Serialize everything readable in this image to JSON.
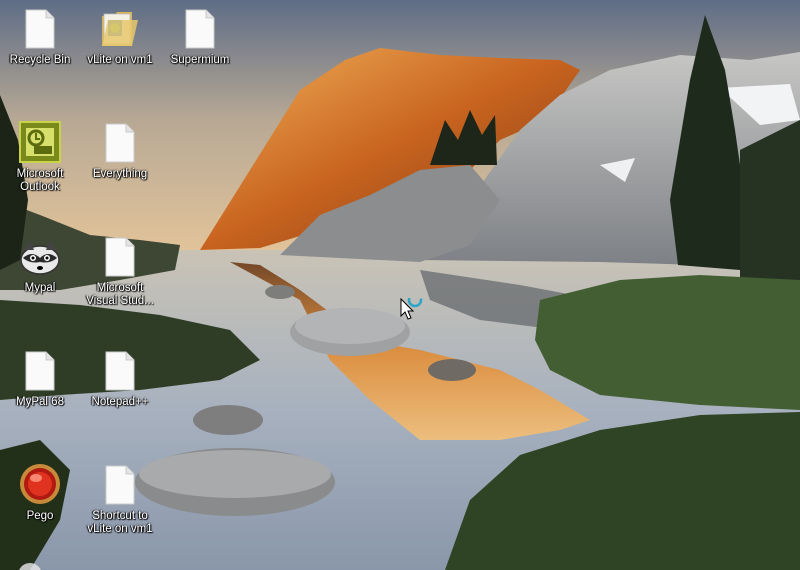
{
  "desktop": {
    "icons": [
      {
        "label": "Recycle Bin",
        "icon": "blank-file-icon"
      },
      {
        "label": "vLite on vm1",
        "icon": "folder-icon"
      },
      {
        "label": "Supermium",
        "icon": "blank-file-icon"
      },
      {
        "label": "Microsoft Outlook",
        "icon": "outlook-icon"
      },
      {
        "label": "Everything",
        "icon": "blank-file-icon"
      },
      {
        "label": "Mypal",
        "icon": "raccoon-icon"
      },
      {
        "label": "Microsoft Visual Stud...",
        "icon": "blank-file-icon"
      },
      {
        "label": "MyPal 68",
        "icon": "blank-file-icon"
      },
      {
        "label": "Notepad++",
        "icon": "blank-file-icon"
      },
      {
        "label": "Pego",
        "icon": "red-orb-icon"
      },
      {
        "label": "Shortcut to vLite on vm1",
        "icon": "blank-file-icon"
      }
    ],
    "cursor": "busy-arrow-cursor",
    "wallpaper": "mountain-lake-sunset"
  },
  "colors": {
    "sky_top": "#6f7e96",
    "peak_glow": "#e8892c",
    "grass": "#3e5a2c",
    "water": "#a9b5c4"
  }
}
